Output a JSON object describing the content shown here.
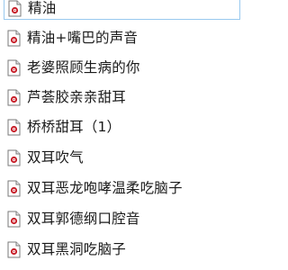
{
  "file_list": {
    "items": [
      {
        "label": "精油",
        "icon": "audio-file-icon",
        "selected": true
      },
      {
        "label": "精油+嘴巴的声音",
        "icon": "audio-file-icon",
        "selected": false
      },
      {
        "label": "老婆照顾生病的你",
        "icon": "audio-file-icon",
        "selected": false
      },
      {
        "label": "芦荟胶亲亲甜耳",
        "icon": "audio-file-icon",
        "selected": false
      },
      {
        "label": "桥桥甜耳（1）",
        "icon": "audio-file-icon",
        "selected": false
      },
      {
        "label": "双耳吹气",
        "icon": "audio-file-icon",
        "selected": false
      },
      {
        "label": "双耳恶龙咆哮温柔吃脑子",
        "icon": "audio-file-icon",
        "selected": false
      },
      {
        "label": "双耳郭德纲口腔音",
        "icon": "audio-file-icon",
        "selected": false
      },
      {
        "label": "双耳黑洞吃脑子",
        "icon": "audio-file-icon",
        "selected": false
      }
    ]
  },
  "colors": {
    "selection_border": "#99c9ef",
    "icon_red": "#c8202a",
    "text": "#1a1a1a"
  }
}
